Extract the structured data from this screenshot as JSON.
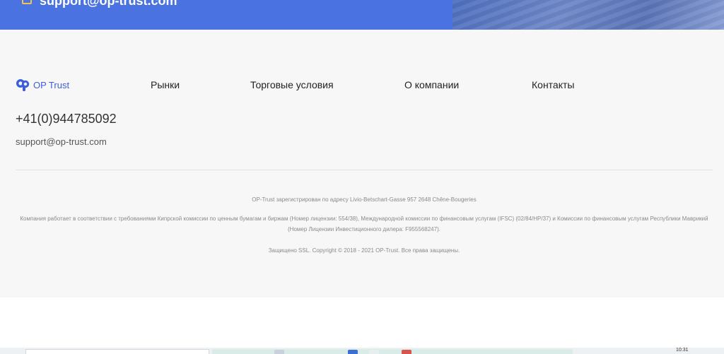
{
  "banner": {
    "email": "support@op-trust.com",
    "icon": "mail-icon",
    "color": "#4a72e0"
  },
  "footer": {
    "logo": {
      "text": "OP Trust",
      "color": "#3a5fd8"
    },
    "nav": [
      {
        "label": "Рынки"
      },
      {
        "label": "Торговые условия"
      },
      {
        "label": "О компании"
      },
      {
        "label": "Контакты"
      }
    ],
    "phone": "+41(0)944785092",
    "email": "support@op-trust.com",
    "legal": [
      "OP-Trust зарегистрирован по адресу Livio-Betschart-Gasse 957 2648 Chêne-Bougeries",
      "Компания работает в соответствии с требованиями Кипрской комиссии по ценным бумагам и биржам (Номер лицензии: 554/38), Международной комиссии по финансовым услугам (IFSC) (02/84/HP/37) и Комиссии по финансовым услугам Республики Маврикий (Номер Лицензии Инвестиционного дилера: F955568247).",
      "Защищено SSL. Copyright © 2018 - 2021 OP-Trust. Все права защищены."
    ]
  },
  "taskbar": {
    "time": "10:31"
  }
}
